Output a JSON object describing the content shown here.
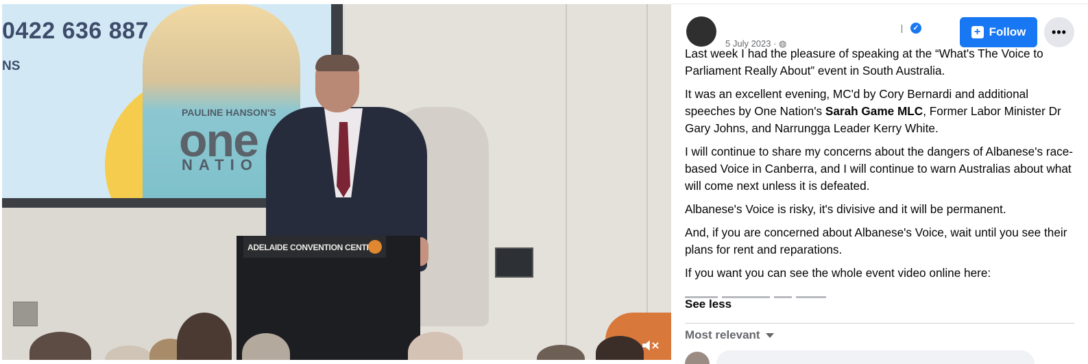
{
  "video": {
    "screen": {
      "phone": "0422 636 887",
      "partial_text": "NS",
      "brand_small": "PAULINE HANSON'S",
      "brand_big": "one",
      "brand_nation": "NATIO"
    },
    "podium_label": "ADELAIDE CONVENTION CENTRE",
    "mute_icon": "muted-speaker-icon"
  },
  "post": {
    "author_name": "",
    "verified_icon": "verified-badge-icon",
    "date": "5 July 2023 · ",
    "audience_icon": "globe-icon",
    "follow_label": "Follow",
    "more_label": "•••",
    "paragraphs": {
      "p1": "Last week I had the pleasure of speaking at the “What's The Voice to Parliament Really About” event in South Australia.",
      "p2_a": "It was an excellent evening, MC'd by Cory Bernardi and additional speeches by One Nation's ",
      "p2_bold": "Sarah Game MLC",
      "p2_b": ", Former Labor Minister Dr Gary Johns, and Narrungga Leader Kerry White.",
      "p3": "I will continue to share my concerns about the dangers of Albanese's race-based Voice in Canberra, and I will continue to warn Australias about what will come next unless it is defeated.",
      "p4": "Albanese's Voice is risky, it's divisive and it will be permanent.",
      "p5": "And, if you are concerned about Albanese's Voice, wait until you see their plans for rent and reparations.",
      "p6": "If you want you can see the whole event video online here:"
    },
    "see_less": "See less",
    "sort_label": "Most relevant",
    "colors": {
      "accent": "#1877f2",
      "secondary_text": "#65676b",
      "primary_text": "#050505"
    }
  }
}
